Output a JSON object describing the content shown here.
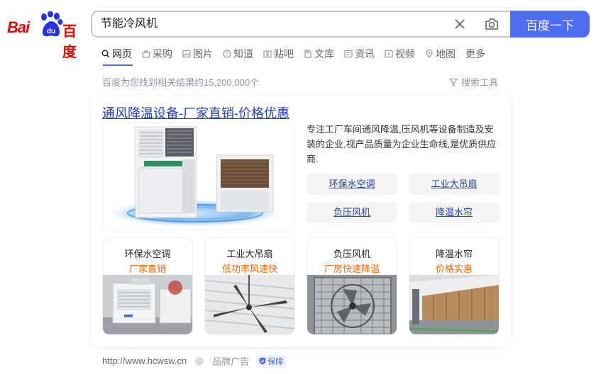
{
  "logo": {
    "bai": "Bai",
    "du": "du",
    "name_cn": "百度"
  },
  "search": {
    "query": "节能冷风机",
    "button_label": "百度一下"
  },
  "tabs": [
    {
      "label": "网页",
      "icon": "search-icon"
    },
    {
      "label": "采购",
      "icon": "basket-icon"
    },
    {
      "label": "图片",
      "icon": "image-icon"
    },
    {
      "label": "知道",
      "icon": "question-icon"
    },
    {
      "label": "贴吧",
      "icon": "tieba-icon"
    },
    {
      "label": "文库",
      "icon": "document-icon"
    },
    {
      "label": "资讯",
      "icon": "news-icon"
    },
    {
      "label": "视频",
      "icon": "video-icon"
    },
    {
      "label": "地图",
      "icon": "map-icon"
    },
    {
      "label": "更多",
      "icon": ""
    }
  ],
  "stats": {
    "text": "百度为您找到相关结果约15,200,000个",
    "tools_label": "搜索工具"
  },
  "ad": {
    "title": "通风降温设备-厂家直销-价格优惠",
    "description": "专注工厂车间通风降温,压风机等设备制造及安装的企业,视产品质量为企业生命线,是优质供应商.",
    "links": [
      "环保水空调",
      "工业大吊扇",
      "负压风机",
      "降温水帘"
    ],
    "cards": [
      {
        "title": "环保水空调",
        "tag": "厂家直销"
      },
      {
        "title": "工业大吊扇",
        "tag": "低功率风速快"
      },
      {
        "title": "负压风机",
        "tag": "厂房快速降温"
      },
      {
        "title": "降温水帘",
        "tag": "价格实惠"
      }
    ]
  },
  "footer": {
    "url": "http://www.hcwsw.cn",
    "ad_label": "品牌广告",
    "badge": "保障"
  },
  "colors": {
    "brand_blue": "#4e6ef2",
    "link_blue": "#2440b3",
    "baidu_red": "#e10602",
    "tag_orange": "#ff6600"
  }
}
